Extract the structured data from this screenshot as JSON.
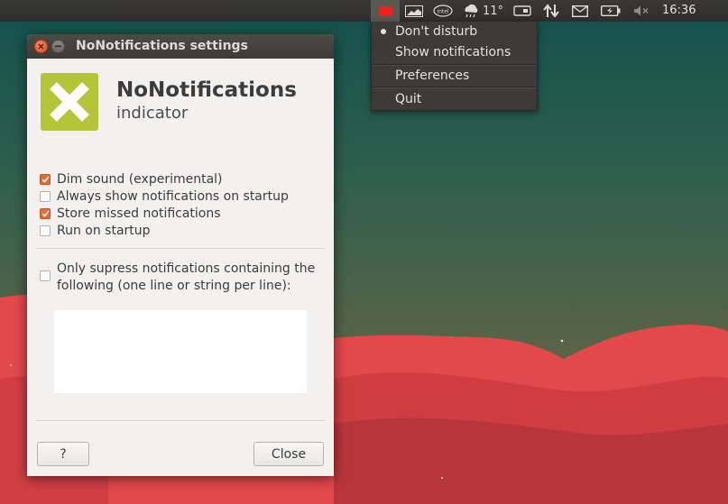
{
  "panel": {
    "temperature": "11°",
    "clock": "16:36",
    "icons": [
      "nonotifications-indicator-icon",
      "system-monitor-icon",
      "intel-icon",
      "weather-icon",
      "removable-drive-icon",
      "network-updown-icon",
      "mail-icon",
      "battery-icon",
      "sound-muted-icon"
    ]
  },
  "menu": {
    "items": [
      {
        "label": "Don't disturb",
        "selected": true
      },
      {
        "label": "Show notifications",
        "selected": false
      },
      {
        "label": "Preferences",
        "selected": false
      },
      {
        "label": "Quit",
        "selected": false
      }
    ]
  },
  "window": {
    "title": "NoNotifications settings",
    "app_name": "NoNotifications",
    "app_subtitle": "indicator",
    "options": [
      {
        "label": "Dim sound (experimental)",
        "checked": true
      },
      {
        "label": "Always show notifications on startup",
        "checked": false
      },
      {
        "label": "Store missed notifications",
        "checked": true
      },
      {
        "label": "Run on startup",
        "checked": false
      }
    ],
    "filter_option": {
      "label": "Only supress notifications containing the following (one line or string per line):",
      "checked": false,
      "text": ""
    },
    "help_label": "?",
    "close_label": "Close"
  },
  "colors": {
    "accent": "#e36b34",
    "logo": "#b5c53a",
    "indicator_red": "#e8241c",
    "desktop_top": "#1d4f4a",
    "hills": "#e3484a"
  }
}
